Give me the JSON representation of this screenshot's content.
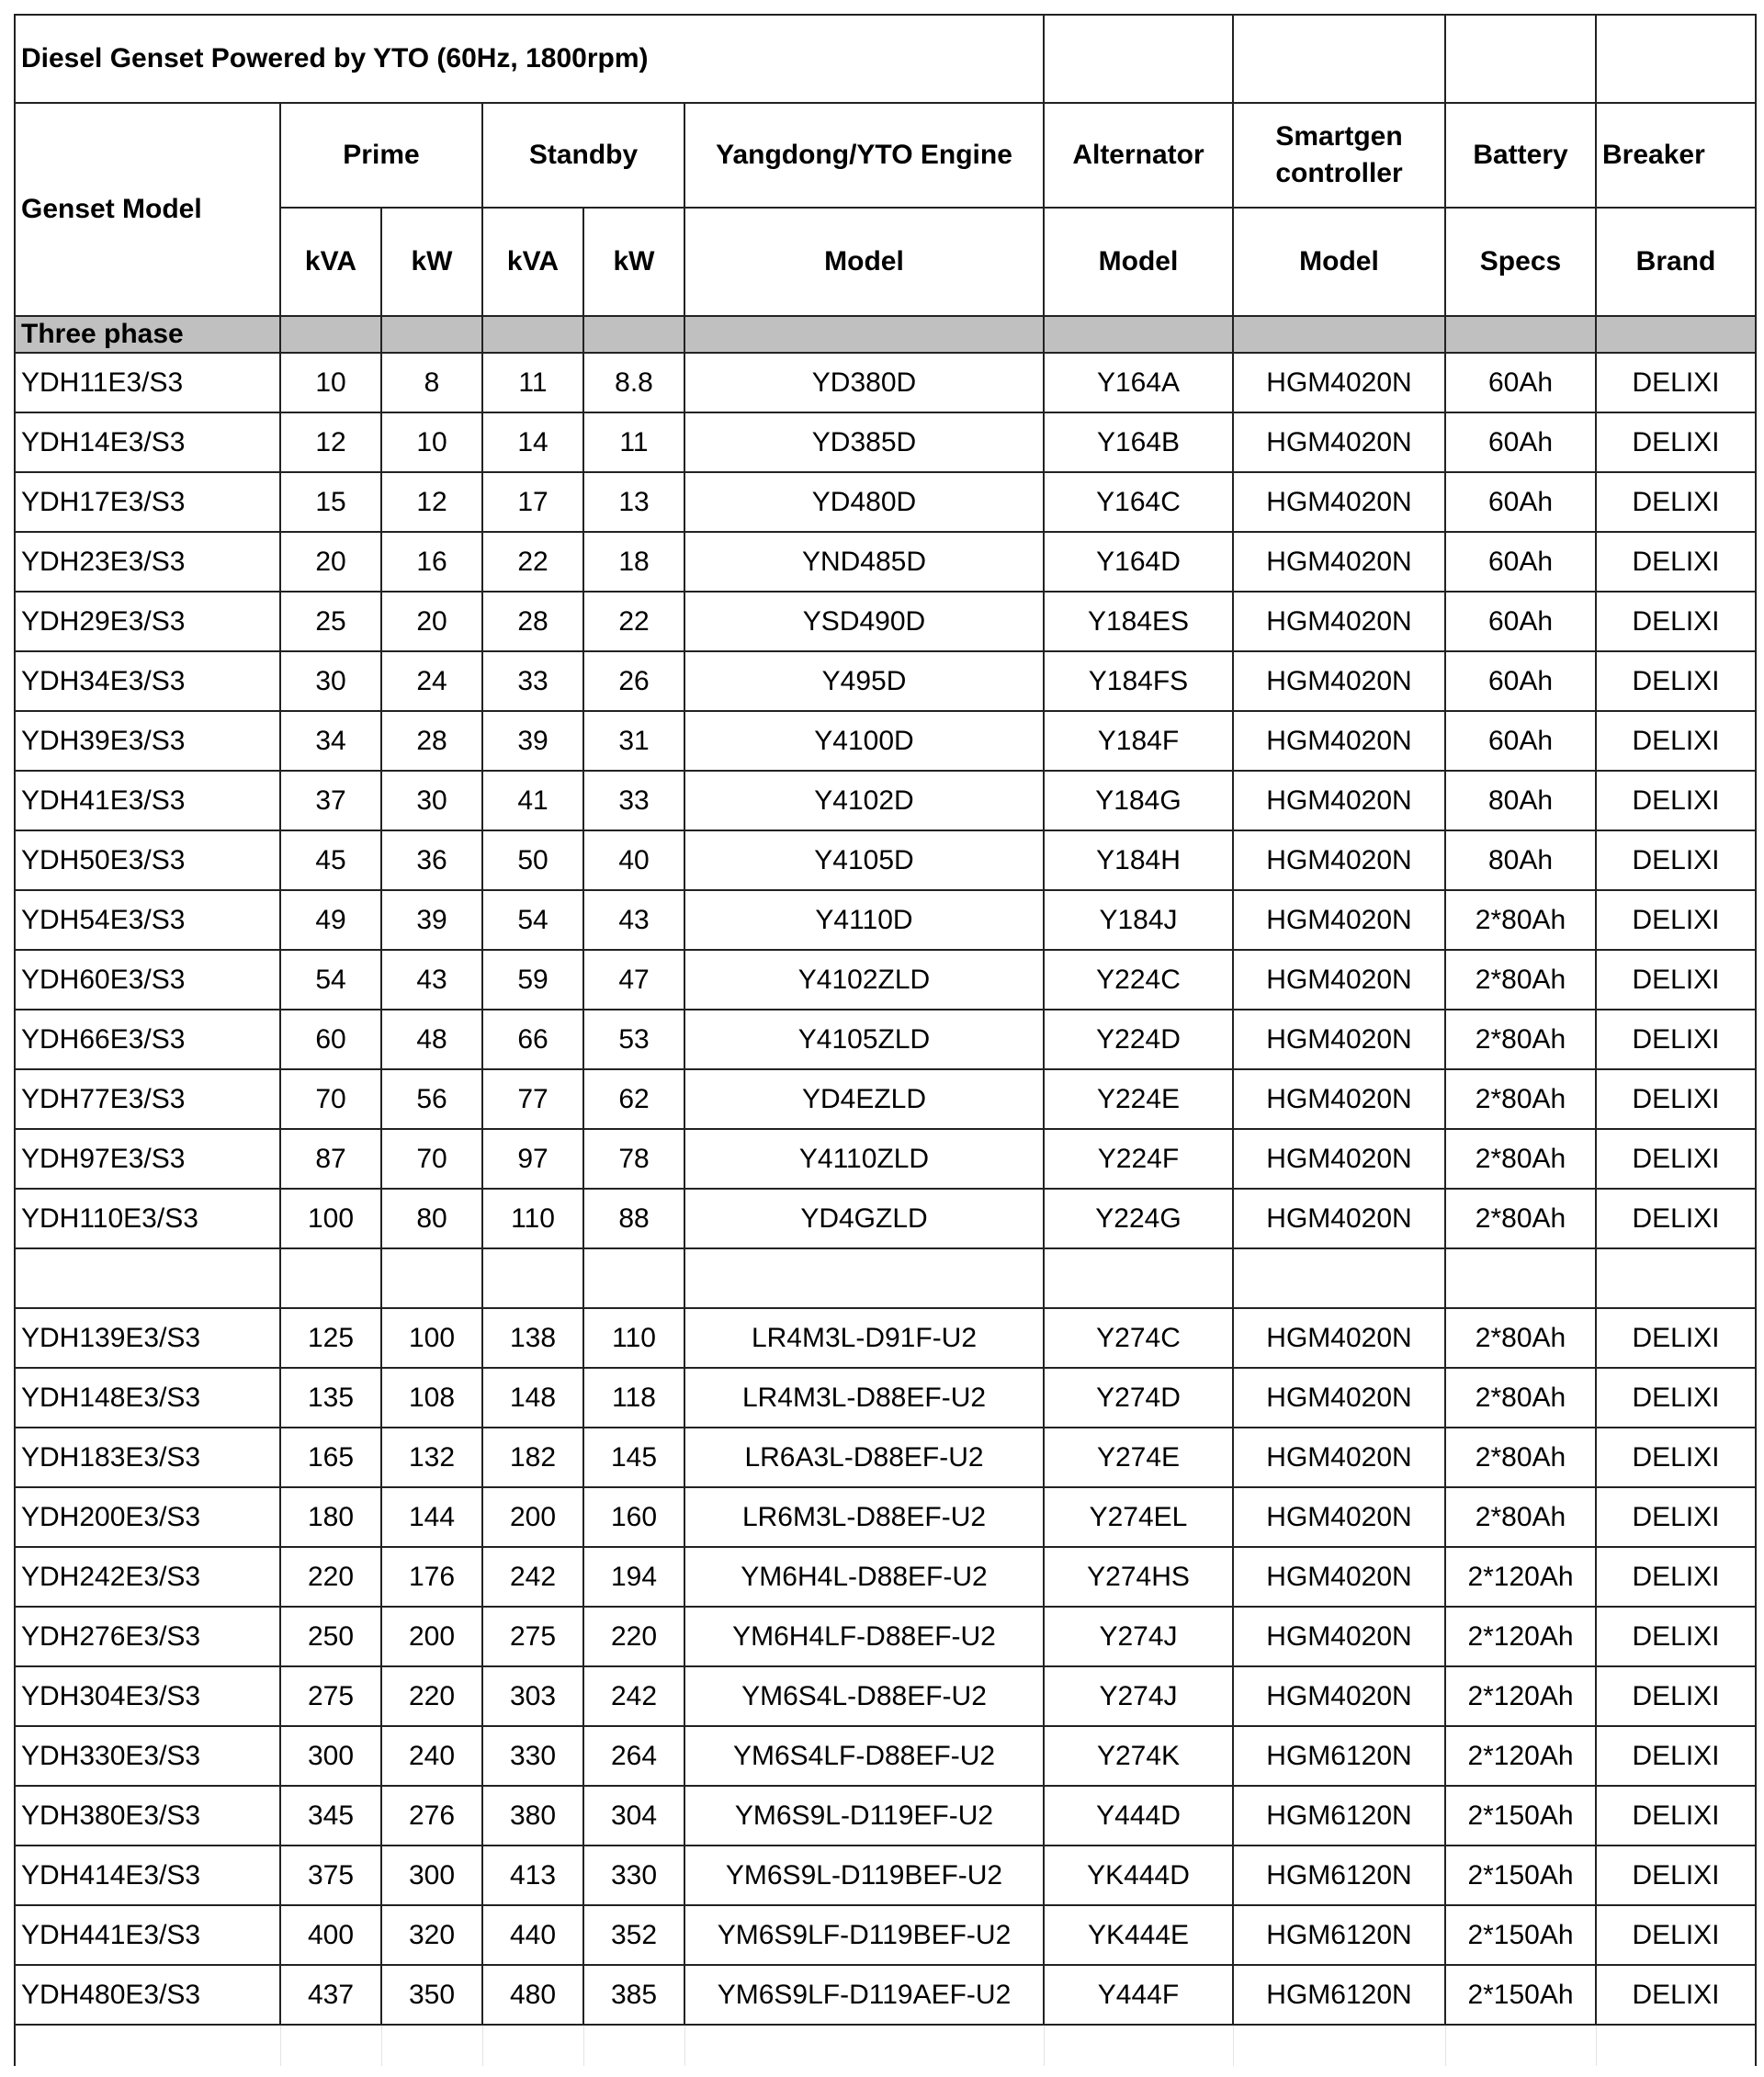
{
  "title": "Diesel Genset Powered by YTO (60Hz, 1800rpm)",
  "headers": {
    "genset_model": "Genset Model",
    "prime": "Prime",
    "standby": "Standby",
    "engine": "Yangdong/YTO Engine",
    "alternator": "Alternator",
    "controller": "Smartgen controller",
    "battery": "Battery",
    "breaker": "Breaker",
    "kva": "kVA",
    "kw": "kW",
    "model": "Model",
    "specs": "Specs",
    "brand": "Brand"
  },
  "section": "Three phase",
  "group1": [
    [
      "YDH11E3/S3",
      "10",
      "8",
      "11",
      "8.8",
      "YD380D",
      "Y164A",
      "HGM4020N",
      "60Ah",
      "DELIXI"
    ],
    [
      "YDH14E3/S3",
      "12",
      "10",
      "14",
      "11",
      "YD385D",
      "Y164B",
      "HGM4020N",
      "60Ah",
      "DELIXI"
    ],
    [
      "YDH17E3/S3",
      "15",
      "12",
      "17",
      "13",
      "YD480D",
      "Y164C",
      "HGM4020N",
      "60Ah",
      "DELIXI"
    ],
    [
      "YDH23E3/S3",
      "20",
      "16",
      "22",
      "18",
      "YND485D",
      "Y164D",
      "HGM4020N",
      "60Ah",
      "DELIXI"
    ],
    [
      "YDH29E3/S3",
      "25",
      "20",
      "28",
      "22",
      "YSD490D",
      "Y184ES",
      "HGM4020N",
      "60Ah",
      "DELIXI"
    ],
    [
      "YDH34E3/S3",
      "30",
      "24",
      "33",
      "26",
      "Y495D",
      "Y184FS",
      "HGM4020N",
      "60Ah",
      "DELIXI"
    ],
    [
      "YDH39E3/S3",
      "34",
      "28",
      "39",
      "31",
      "Y4100D",
      "Y184F",
      "HGM4020N",
      "60Ah",
      "DELIXI"
    ],
    [
      "YDH41E3/S3",
      "37",
      "30",
      "41",
      "33",
      "Y4102D",
      "Y184G",
      "HGM4020N",
      "80Ah",
      "DELIXI"
    ],
    [
      "YDH50E3/S3",
      "45",
      "36",
      "50",
      "40",
      "Y4105D",
      "Y184H",
      "HGM4020N",
      "80Ah",
      "DELIXI"
    ],
    [
      "YDH54E3/S3",
      "49",
      "39",
      "54",
      "43",
      "Y4110D",
      "Y184J",
      "HGM4020N",
      "2*80Ah",
      "DELIXI"
    ],
    [
      "YDH60E3/S3",
      "54",
      "43",
      "59",
      "47",
      "Y4102ZLD",
      "Y224C",
      "HGM4020N",
      "2*80Ah",
      "DELIXI"
    ],
    [
      "YDH66E3/S3",
      "60",
      "48",
      "66",
      "53",
      "Y4105ZLD",
      "Y224D",
      "HGM4020N",
      "2*80Ah",
      "DELIXI"
    ],
    [
      "YDH77E3/S3",
      "70",
      "56",
      "77",
      "62",
      "YD4EZLD",
      "Y224E",
      "HGM4020N",
      "2*80Ah",
      "DELIXI"
    ],
    [
      "YDH97E3/S3",
      "87",
      "70",
      "97",
      "78",
      "Y4110ZLD",
      "Y224F",
      "HGM4020N",
      "2*80Ah",
      "DELIXI"
    ],
    [
      "YDH110E3/S3",
      "100",
      "80",
      "110",
      "88",
      "YD4GZLD",
      "Y224G",
      "HGM4020N",
      "2*80Ah",
      "DELIXI"
    ]
  ],
  "group2": [
    [
      "YDH139E3/S3",
      "125",
      "100",
      "138",
      "110",
      "LR4M3L-D91F-U2",
      "Y274C",
      "HGM4020N",
      "2*80Ah",
      "DELIXI"
    ],
    [
      "YDH148E3/S3",
      "135",
      "108",
      "148",
      "118",
      "LR4M3L-D88EF-U2",
      "Y274D",
      "HGM4020N",
      "2*80Ah",
      "DELIXI"
    ],
    [
      "YDH183E3/S3",
      "165",
      "132",
      "182",
      "145",
      "LR6A3L-D88EF-U2",
      "Y274E",
      "HGM4020N",
      "2*80Ah",
      "DELIXI"
    ],
    [
      "YDH200E3/S3",
      "180",
      "144",
      "200",
      "160",
      "LR6M3L-D88EF-U2",
      "Y274EL",
      "HGM4020N",
      "2*80Ah",
      "DELIXI"
    ],
    [
      "YDH242E3/S3",
      "220",
      "176",
      "242",
      "194",
      "YM6H4L-D88EF-U2",
      "Y274HS",
      "HGM4020N",
      "2*120Ah",
      "DELIXI"
    ],
    [
      "YDH276E3/S3",
      "250",
      "200",
      "275",
      "220",
      "YM6H4LF-D88EF-U2",
      "Y274J",
      "HGM4020N",
      "2*120Ah",
      "DELIXI"
    ],
    [
      "YDH304E3/S3",
      "275",
      "220",
      "303",
      "242",
      "YM6S4L-D88EF-U2",
      "Y274J",
      "HGM4020N",
      "2*120Ah",
      "DELIXI"
    ],
    [
      "YDH330E3/S3",
      "300",
      "240",
      "330",
      "264",
      "YM6S4LF-D88EF-U2",
      "Y274K",
      "HGM6120N",
      "2*120Ah",
      "DELIXI"
    ],
    [
      "YDH380E3/S3",
      "345",
      "276",
      "380",
      "304",
      "YM6S9L-D119EF-U2",
      "Y444D",
      "HGM6120N",
      "2*150Ah",
      "DELIXI"
    ],
    [
      "YDH414E3/S3",
      "375",
      "300",
      "413",
      "330",
      "YM6S9L-D119BEF-U2",
      "YK444D",
      "HGM6120N",
      "2*150Ah",
      "DELIXI"
    ],
    [
      "YDH441E3/S3",
      "400",
      "320",
      "440",
      "352",
      "YM6S9LF-D119BEF-U2",
      "YK444E",
      "HGM6120N",
      "2*150Ah",
      "DELIXI"
    ],
    [
      "YDH480E3/S3",
      "437",
      "350",
      "480",
      "385",
      "YM6S9LF-D119AEF-U2",
      "Y444F",
      "HGM6120N",
      "2*150Ah",
      "DELIXI"
    ]
  ]
}
